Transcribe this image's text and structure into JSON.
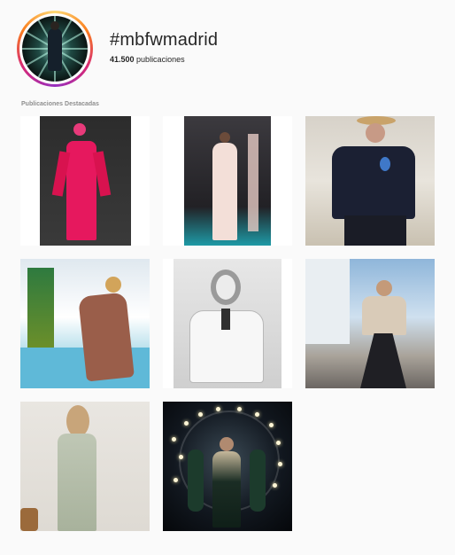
{
  "header": {
    "title": "#mbfwmadrid",
    "count_value": "41.500",
    "count_label": "publicaciones"
  },
  "section": {
    "label": "Publicaciones Destacadas"
  },
  "posts": [
    {
      "name": "post-1"
    },
    {
      "name": "post-2"
    },
    {
      "name": "post-3"
    },
    {
      "name": "post-4"
    },
    {
      "name": "post-5"
    },
    {
      "name": "post-6"
    },
    {
      "name": "post-7"
    },
    {
      "name": "post-8"
    }
  ],
  "colors": {
    "background": "#fafafa",
    "text": "#262626",
    "muted": "#8e8e8e",
    "ring_start": "#feda75",
    "ring_end": "#962fbf"
  }
}
